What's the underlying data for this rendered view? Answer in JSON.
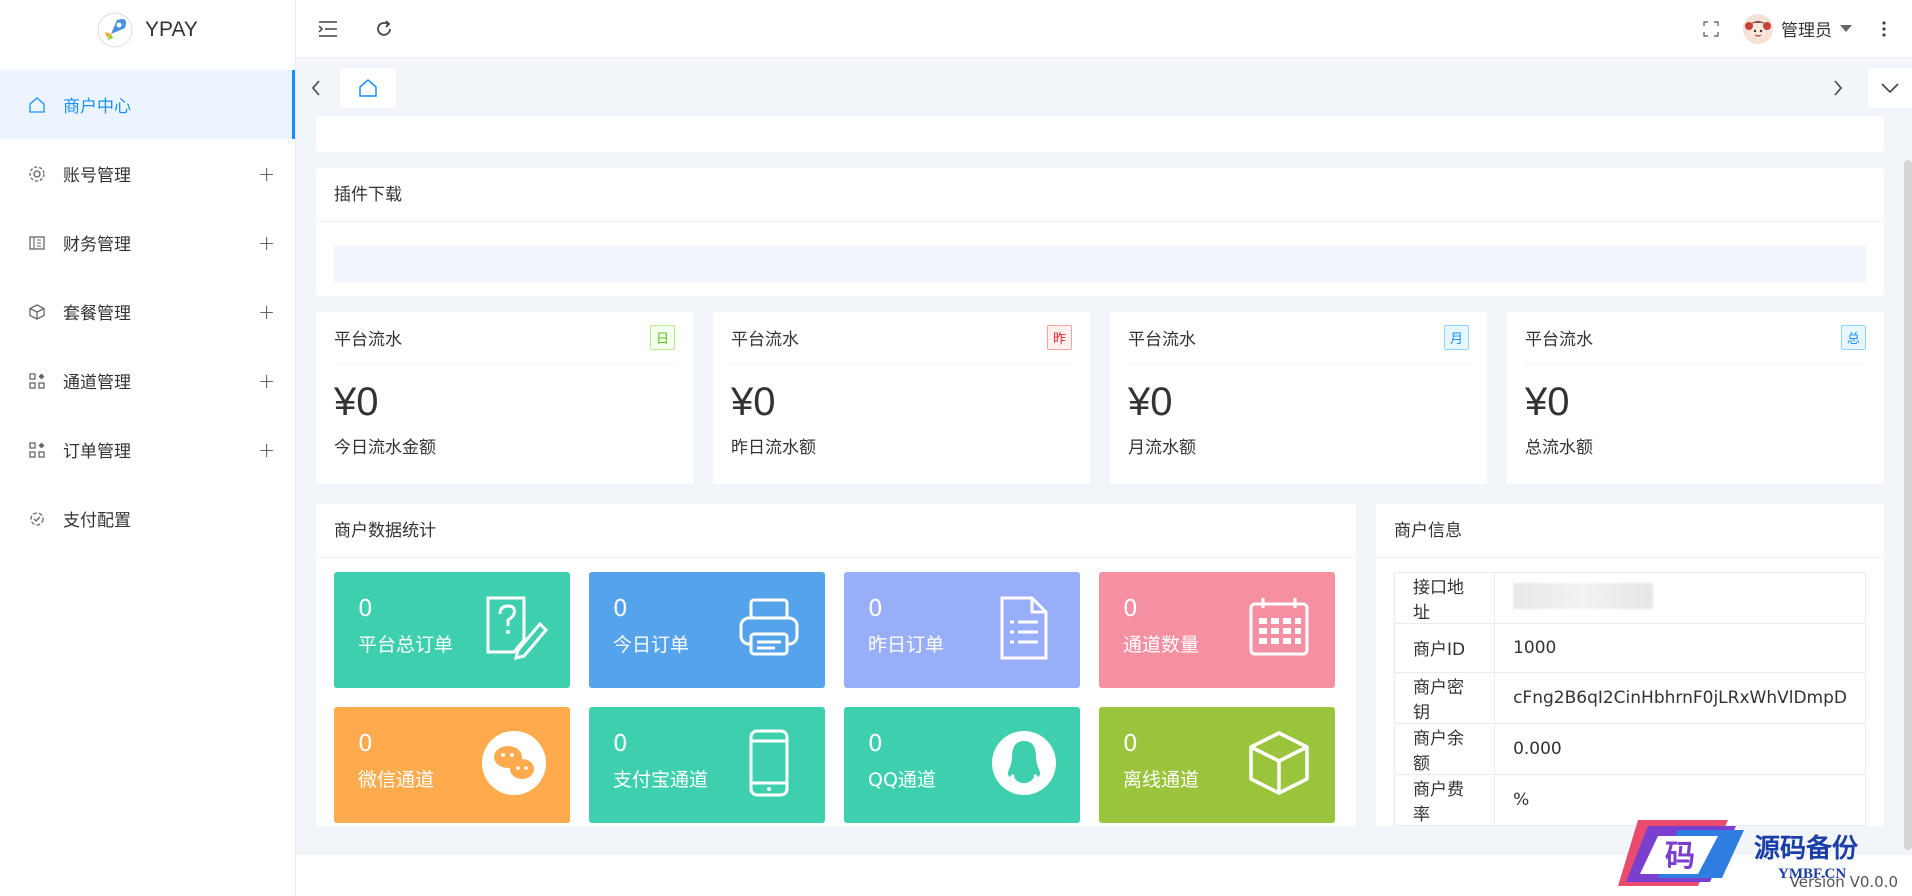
{
  "app": {
    "logo_text": "YPAY"
  },
  "sidebar": {
    "items": [
      {
        "label": "商户中心",
        "icon": "home-icon",
        "active": true,
        "expandable": false
      },
      {
        "label": "账号管理",
        "icon": "gear-icon",
        "expandable": true
      },
      {
        "label": "财务管理",
        "icon": "finance-icon",
        "expandable": true
      },
      {
        "label": "套餐管理",
        "icon": "cube-icon",
        "expandable": true
      },
      {
        "label": "通道管理",
        "icon": "apps-icon",
        "expandable": true
      },
      {
        "label": "订单管理",
        "icon": "apps-icon",
        "expandable": true
      },
      {
        "label": "支付配置",
        "icon": "config-icon",
        "expandable": false
      }
    ],
    "expand_symbol": "+"
  },
  "header": {
    "user_name": "管理员"
  },
  "plugin": {
    "title": "插件下载"
  },
  "stats": [
    {
      "title": "平台流水",
      "badge": "日",
      "badge_color": "green",
      "value": "¥0",
      "label": "今日流水金额"
    },
    {
      "title": "平台流水",
      "badge": "昨",
      "badge_color": "red",
      "value": "¥0",
      "label": "昨日流水额"
    },
    {
      "title": "平台流水",
      "badge": "月",
      "badge_color": "blue",
      "value": "¥0",
      "label": "月流水额"
    },
    {
      "title": "平台流水",
      "badge": "总",
      "badge_color": "blue",
      "value": "¥0",
      "label": "总流水额"
    }
  ],
  "merchant_stats": {
    "title": "商户数据统计",
    "tiles": [
      {
        "num": "0",
        "label": "平台总订单",
        "color": "#3ecfae",
        "icon": "edit-doc-icon"
      },
      {
        "num": "0",
        "label": "今日订单",
        "color": "#55a3ea",
        "icon": "printer-icon"
      },
      {
        "num": "0",
        "label": "昨日订单",
        "color": "#98aef9",
        "icon": "document-icon"
      },
      {
        "num": "0",
        "label": "通道数量",
        "color": "#f590a3",
        "icon": "calendar-icon"
      },
      {
        "num": "0",
        "label": "微信通道",
        "color": "#fdab4d",
        "icon": "wechat-icon"
      },
      {
        "num": "0",
        "label": "支付宝通道",
        "color": "#3ecfae",
        "icon": "phone-icon"
      },
      {
        "num": "0",
        "label": "QQ通道",
        "color": "#3ecfae",
        "icon": "qq-icon"
      },
      {
        "num": "0",
        "label": "离线通道",
        "color": "#99c43b",
        "icon": "box-icon"
      }
    ]
  },
  "merchant_info": {
    "title": "商户信息",
    "rows": [
      {
        "key": "接口地址",
        "value": ""
      },
      {
        "key": "商户ID",
        "value": "1000"
      },
      {
        "key": "商户密钥",
        "value": "cFng2B6qI2CinHbhrnF0jLRxWhVlDmpD"
      },
      {
        "key": "商户余额",
        "value": "0.000"
      },
      {
        "key": "商户费率",
        "value": "%"
      }
    ]
  },
  "footer": {
    "version": "Version V0.0.0"
  },
  "watermark": {
    "title": "源码备份",
    "sub": "YMBF.CN",
    "badge": "码"
  }
}
